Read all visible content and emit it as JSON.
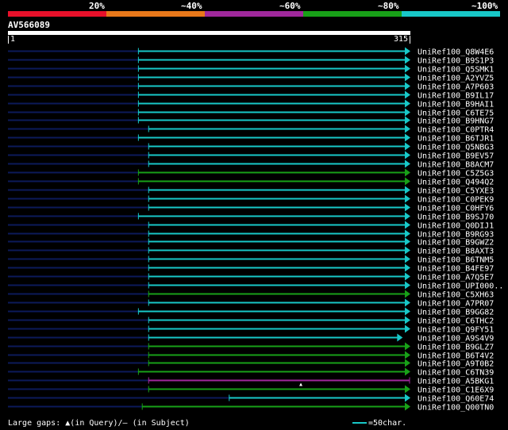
{
  "legend": {
    "segments": [
      {
        "label": "20%",
        "color": "#e8102a"
      },
      {
        "label": "~40%",
        "color": "#e8781a"
      },
      {
        "label": "~60%",
        "color": "#a0289c"
      },
      {
        "label": "~80%",
        "color": "#18a018"
      },
      {
        "label": "~100%",
        "color": "#18c8c8"
      }
    ]
  },
  "query": {
    "name": "AV566089",
    "start_label": "1",
    "end_label": "315",
    "length": 315
  },
  "colors": {
    "background": "#000000",
    "unaligned_track": "#0c1a5a",
    "c100": "#18c8c8",
    "c80": "#18a018",
    "c60": "#a0289c"
  },
  "hits": [
    {
      "label": "UniRef100_Q8W4E6",
      "start": 103,
      "end": 315,
      "class": "c100",
      "arrow": true
    },
    {
      "label": "UniRef100_B9S1P3",
      "start": 103,
      "end": 315,
      "class": "c100",
      "arrow": true
    },
    {
      "label": "UniRef100_Q5SMK1",
      "start": 103,
      "end": 315,
      "class": "c100",
      "arrow": true
    },
    {
      "label": "UniRef100_A2YVZ5",
      "start": 103,
      "end": 315,
      "class": "c100",
      "arrow": true
    },
    {
      "label": "UniRef100_A7P603",
      "start": 103,
      "end": 315,
      "class": "c100",
      "arrow": true
    },
    {
      "label": "UniRef100_B9IL17",
      "start": 103,
      "end": 315,
      "class": "c100",
      "arrow": true
    },
    {
      "label": "UniRef100_B9HAI1",
      "start": 103,
      "end": 315,
      "class": "c100",
      "arrow": true
    },
    {
      "label": "UniRef100_C6TE75",
      "start": 103,
      "end": 315,
      "class": "c100",
      "arrow": true
    },
    {
      "label": "UniRef100_B9HNG7",
      "start": 103,
      "end": 315,
      "class": "c100",
      "arrow": true
    },
    {
      "label": "UniRef100_C0PTR4",
      "start": 111,
      "end": 315,
      "class": "c100",
      "arrow": true
    },
    {
      "label": "UniRef100_B6TJR1",
      "start": 103,
      "end": 315,
      "class": "c100",
      "arrow": true
    },
    {
      "label": "UniRef100_Q5NBG3",
      "start": 111,
      "end": 315,
      "class": "c100",
      "arrow": true
    },
    {
      "label": "UniRef100_B9EV57",
      "start": 111,
      "end": 315,
      "class": "c100",
      "arrow": true
    },
    {
      "label": "UniRef100_B8ACM7",
      "start": 111,
      "end": 315,
      "class": "c100",
      "arrow": true
    },
    {
      "label": "UniRef100_C5Z5G3",
      "start": 103,
      "end": 315,
      "class": "c80",
      "arrow": true
    },
    {
      "label": "UniRef100_Q494Q2",
      "start": 103,
      "end": 315,
      "class": "c80",
      "arrow": true
    },
    {
      "label": "UniRef100_C5YXE3",
      "start": 111,
      "end": 315,
      "class": "c100",
      "arrow": true
    },
    {
      "label": "UniRef100_C0PEK9",
      "start": 111,
      "end": 315,
      "class": "c100",
      "arrow": true
    },
    {
      "label": "UniRef100_C0HFY6",
      "start": 111,
      "end": 315,
      "class": "c100",
      "arrow": true
    },
    {
      "label": "UniRef100_B9SJ70",
      "start": 103,
      "end": 315,
      "class": "c100",
      "arrow": true
    },
    {
      "label": "UniRef100_Q0DIJ1",
      "start": 111,
      "end": 315,
      "class": "c100",
      "arrow": true
    },
    {
      "label": "UniRef100_B9RG93",
      "start": 111,
      "end": 315,
      "class": "c100",
      "arrow": true
    },
    {
      "label": "UniRef100_B9GWZ2",
      "start": 111,
      "end": 315,
      "class": "c100",
      "arrow": true
    },
    {
      "label": "UniRef100_B8AXT3",
      "start": 111,
      "end": 315,
      "class": "c100",
      "arrow": true
    },
    {
      "label": "UniRef100_B6TNM5",
      "start": 111,
      "end": 315,
      "class": "c100",
      "arrow": true
    },
    {
      "label": "UniRef100_B4FE97",
      "start": 111,
      "end": 315,
      "class": "c100",
      "arrow": true
    },
    {
      "label": "UniRef100_A7Q5E7",
      "start": 111,
      "end": 315,
      "class": "c100",
      "arrow": true
    },
    {
      "label": "UniRef100_UPI000..",
      "start": 111,
      "end": 315,
      "class": "c100",
      "arrow": true
    },
    {
      "label": "UniRef100_C5XH63",
      "start": 111,
      "end": 315,
      "class": "c80",
      "arrow": true
    },
    {
      "label": "UniRef100_A7PR07",
      "start": 111,
      "end": 315,
      "class": "c100",
      "arrow": true
    },
    {
      "label": "UniRef100_B9GG82",
      "start": 103,
      "end": 315,
      "class": "c100",
      "arrow": true
    },
    {
      "label": "UniRef100_C6THC2",
      "start": 111,
      "end": 315,
      "class": "c100",
      "arrow": true
    },
    {
      "label": "UniRef100_Q9FY51",
      "start": 111,
      "end": 315,
      "class": "c100",
      "arrow": true
    },
    {
      "label": "UniRef100_A9S4V9",
      "start": 111,
      "end": 309,
      "class": "c100",
      "arrow": true
    },
    {
      "label": "UniRef100_B9GLZ7",
      "start": 111,
      "end": 315,
      "class": "c80",
      "arrow": true
    },
    {
      "label": "UniRef100_B6T4V2",
      "start": 111,
      "end": 315,
      "class": "c80",
      "arrow": true
    },
    {
      "label": "UniRef100_A9T0B2",
      "start": 111,
      "end": 315,
      "class": "c80",
      "arrow": true
    },
    {
      "label": "UniRef100_C6TN39",
      "start": 103,
      "end": 315,
      "class": "c80",
      "arrow": true
    },
    {
      "label": "UniRef100_A5BKG1",
      "start": 111,
      "end": 315,
      "class": "c60",
      "arrow": false,
      "gap_at": 230
    },
    {
      "label": "UniRef100_C1E6X9",
      "start": 111,
      "end": 315,
      "class": "c80",
      "arrow": true
    },
    {
      "label": "UniRef100_Q60E74",
      "start": 174,
      "end": 315,
      "class": "c100",
      "arrow": true
    },
    {
      "label": "UniRef100_Q00TN0",
      "start": 106,
      "end": 315,
      "class": "c80",
      "arrow": true
    }
  ],
  "footer": {
    "gaps_label": "Large gaps:",
    "query_gap_symbol": "▲",
    "query_gap_text": "(in Query)/",
    "subject_gap_symbol": "–",
    "subject_gap_text": " (in Subject)",
    "scale_text": "=50char."
  }
}
